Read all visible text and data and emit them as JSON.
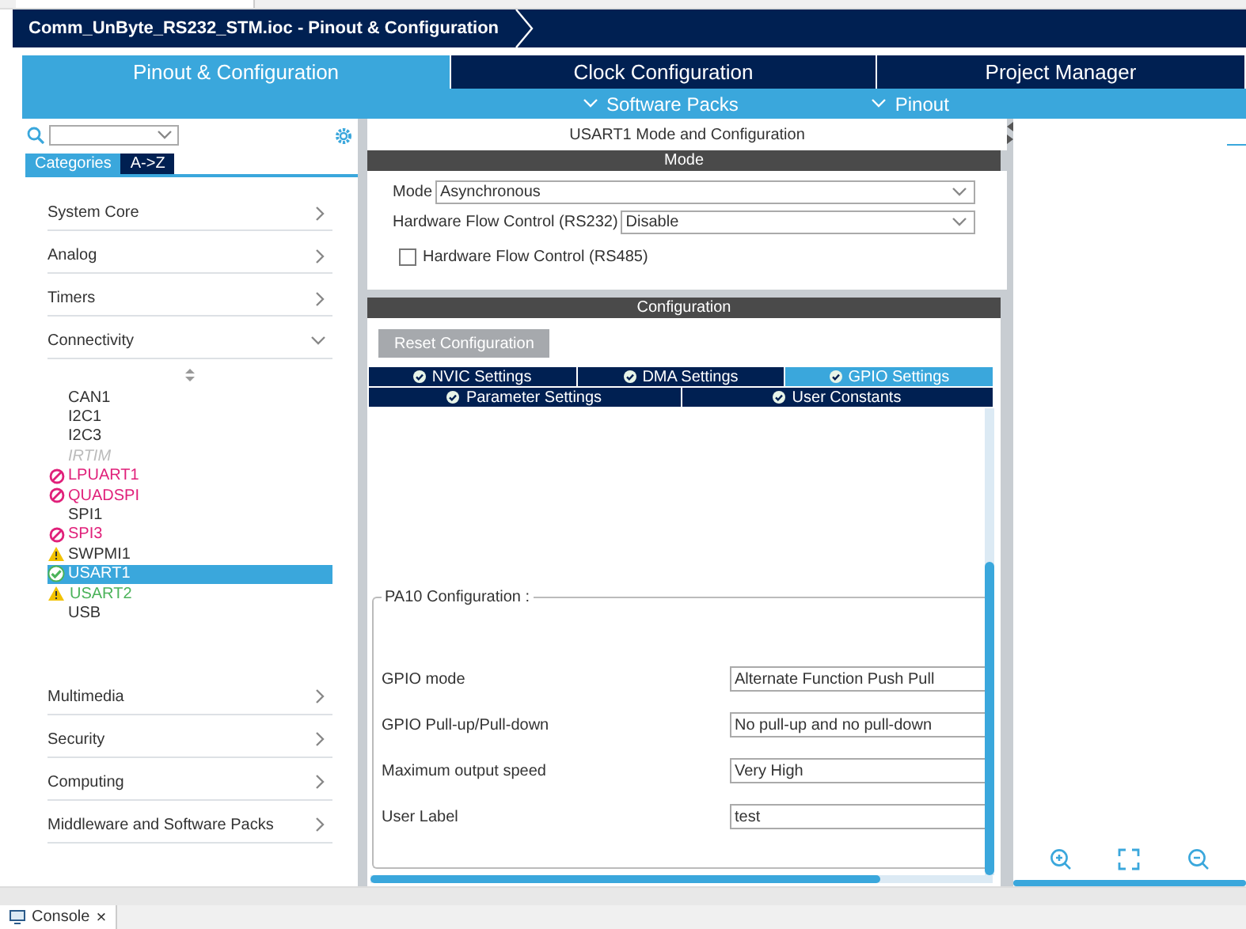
{
  "breadcrumb": {
    "title": "Comm_UnByte_RS232_STM.ioc - Pinout & Configuration"
  },
  "main_tabs": [
    {
      "label": "Pinout & Configuration",
      "selected": true
    },
    {
      "label": "Clock Configuration",
      "selected": false
    },
    {
      "label": "Project Manager",
      "selected": false
    }
  ],
  "sub_menus": [
    {
      "label": "Software Packs"
    },
    {
      "label": "Pinout"
    }
  ],
  "sidebar": {
    "view_tabs": [
      {
        "label": "Categories",
        "selected": true
      },
      {
        "label": "A->Z",
        "selected": false
      }
    ],
    "categories": [
      {
        "label": "System Core",
        "expanded": false
      },
      {
        "label": "Analog",
        "expanded": false
      },
      {
        "label": "Timers",
        "expanded": false
      },
      {
        "label": "Connectivity",
        "expanded": true,
        "children": [
          {
            "label": "CAN1",
            "kind": "none",
            "configured": false,
            "selected": false
          },
          {
            "label": "I2C1",
            "kind": "none",
            "configured": false,
            "selected": false
          },
          {
            "label": "I2C3",
            "kind": "none",
            "configured": false,
            "selected": false
          },
          {
            "label": "IRTIM",
            "kind": "unavailable",
            "configured": false,
            "selected": false
          },
          {
            "label": "LPUART1",
            "kind": "conflict",
            "configured": false,
            "selected": false
          },
          {
            "label": "QUADSPI",
            "kind": "conflict",
            "configured": false,
            "selected": false
          },
          {
            "label": "SPI1",
            "kind": "none",
            "configured": false,
            "selected": false
          },
          {
            "label": "SPI3",
            "kind": "conflict",
            "configured": false,
            "selected": false
          },
          {
            "label": "SWPMI1",
            "kind": "warning",
            "configured": false,
            "selected": false
          },
          {
            "label": "USART1",
            "kind": "ok",
            "configured": false,
            "selected": true
          },
          {
            "label": "USART2",
            "kind": "warning",
            "configured": true,
            "selected": false
          },
          {
            "label": "USB",
            "kind": "none",
            "configured": false,
            "selected": false
          }
        ]
      },
      {
        "label": "Multimedia",
        "expanded": false
      },
      {
        "label": "Security",
        "expanded": false
      },
      {
        "label": "Computing",
        "expanded": false
      },
      {
        "label": "Middleware and Software Packs",
        "expanded": false
      }
    ]
  },
  "panel": {
    "title": "USART1 Mode and Configuration",
    "mode_section": {
      "title": "Mode",
      "fields": [
        {
          "kind": "select",
          "label": "Mode",
          "value": "Asynchronous"
        },
        {
          "kind": "select",
          "label": "Hardware Flow Control (RS232)",
          "value": "Disable"
        },
        {
          "kind": "checkbox",
          "label": "Hardware Flow Control (RS485)",
          "checked": false
        }
      ]
    },
    "config_section": {
      "title": "Configuration",
      "reset_button": {
        "label": "Reset Configuration",
        "disabled": true
      },
      "tab_rows": [
        [
          {
            "label": "NVIC Settings",
            "selected": false
          },
          {
            "label": "DMA Settings",
            "selected": false
          },
          {
            "label": "GPIO Settings",
            "selected": true
          }
        ],
        [
          {
            "label": "Parameter Settings",
            "selected": false
          },
          {
            "label": "User Constants",
            "selected": false
          }
        ]
      ],
      "group": {
        "title": "PA10 Configuration :",
        "rows": [
          {
            "label": "GPIO mode",
            "value": "Alternate Function Push Pull"
          },
          {
            "label": "GPIO Pull-up/Pull-down",
            "value": "No pull-up and no pull-down"
          },
          {
            "label": "Maximum output speed",
            "value": "Very High"
          },
          {
            "label": "User Label",
            "value": "test"
          }
        ]
      }
    }
  },
  "bottom_tabs": [
    {
      "label": "Console",
      "close": "×"
    }
  ]
}
